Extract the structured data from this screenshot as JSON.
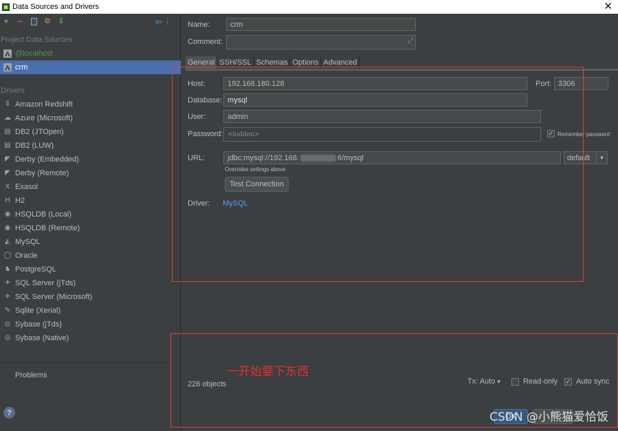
{
  "window": {
    "title": "Data Sources and Drivers",
    "close_glyph": "✕"
  },
  "sidebar": {
    "toolbar": {
      "add_glyph": "+",
      "remove_glyph": "−",
      "properties_glyph": "⚙",
      "import_glyph": "⇩",
      "back_glyph": "⇦"
    },
    "project_section_label": "Project Data Sources",
    "data_sources": [
      {
        "label": "@localhost"
      },
      {
        "label": "crm"
      }
    ],
    "drivers_section_label": "Drivers",
    "drivers": [
      {
        "label": "Amazon Redshift",
        "icon": "bars-icon",
        "glyph": "⫴"
      },
      {
        "label": "Azure (Microsoft)",
        "icon": "cloud-icon",
        "glyph": "☁"
      },
      {
        "label": "DB2 (JTOpen)",
        "icon": "db2-icon",
        "glyph": "▤"
      },
      {
        "label": "DB2 (LUW)",
        "icon": "db2-icon",
        "glyph": "▤"
      },
      {
        "label": "Derby (Embedded)",
        "icon": "hat-icon",
        "glyph": "◤"
      },
      {
        "label": "Derby (Remote)",
        "icon": "hat-icon",
        "glyph": "◤"
      },
      {
        "label": "Exasol",
        "icon": "x-icon",
        "glyph": "X"
      },
      {
        "label": "H2",
        "icon": "h2-icon",
        "glyph": "H"
      },
      {
        "label": "HSQLDB (Local)",
        "icon": "circle-icon",
        "glyph": "◉"
      },
      {
        "label": "HSQLDB (Remote)",
        "icon": "circle-icon",
        "glyph": "◉"
      },
      {
        "label": "MySQL",
        "icon": "mysql-icon",
        "glyph": "◭"
      },
      {
        "label": "Oracle",
        "icon": "oracle-icon",
        "glyph": "◯"
      },
      {
        "label": "PostgreSQL",
        "icon": "elephant-icon",
        "glyph": "♞"
      },
      {
        "label": "SQL Server (jTds)",
        "icon": "sqlserver-icon",
        "glyph": "✈"
      },
      {
        "label": "SQL Server (Microsoft)",
        "icon": "sqlserver-icon",
        "glyph": "✈"
      },
      {
        "label": "Sqlite (Xerial)",
        "icon": "feather-icon",
        "glyph": "✎"
      },
      {
        "label": "Sybase (jTds)",
        "icon": "sybase-icon",
        "glyph": "◎"
      },
      {
        "label": "Sybase (Native)",
        "icon": "sybase-icon",
        "glyph": "◎"
      }
    ],
    "problems_label": "Problems",
    "help_glyph": "?"
  },
  "form": {
    "name_label": "Name:",
    "name_value": "crm",
    "comment_label": "Comment:",
    "comment_value": "",
    "expand_glyph": "⤢",
    "tabs": [
      {
        "label": "General"
      },
      {
        "label": "SSH/SSL"
      },
      {
        "label": "Schemas"
      },
      {
        "label": "Options"
      },
      {
        "label": "Advanced"
      }
    ],
    "host_label": "Host:",
    "host_value": "192.168.180.128",
    "port_label": "Port:",
    "port_value": "3306",
    "database_label": "Database:",
    "database_value": "mysql",
    "user_label": "User:",
    "user_value": "admin",
    "password_label": "Password:",
    "password_placeholder": "<hidden>",
    "remember_password_label": "Remember password",
    "remember_checked_glyph": "✓",
    "url_label": "URL:",
    "url_value": "jdbc:mysql://192.168.",
    "url_value_tail": "6/mysql",
    "url_hint": "Overrides settings above",
    "url_mode": "default",
    "test_connection_label": "Test Connection",
    "driver_label": "Driver:",
    "driver_value": "MySQL"
  },
  "annotation_text": "一开始要下东西",
  "status": {
    "objects_count": "226 objects",
    "tx_label": "Tx: Auto",
    "read_only_label": "Read-only",
    "auto_sync_label": "Auto sync",
    "auto_sync_glyph": "✓",
    "dropdown_glyph": "▾"
  },
  "watermark_text": "CSDN @小熊猫爱恰饭",
  "footer": {
    "ok_label": "OK"
  },
  "colors": {
    "accent_selection": "#4b6eaf",
    "link": "#589df6",
    "annotation_red": "#e04040",
    "localhost_green": "#5c8f47"
  }
}
